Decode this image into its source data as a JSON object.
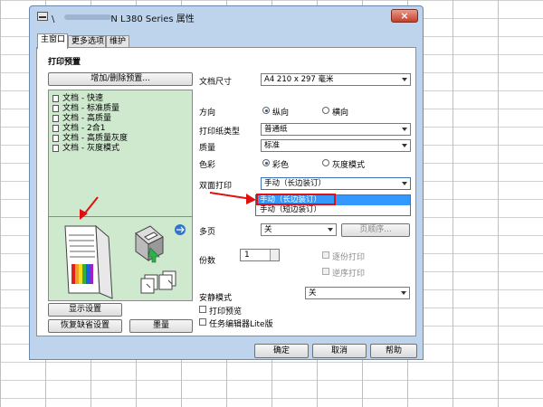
{
  "window": {
    "title_prefix": "\\",
    "title_suffix": "N L380 Series 属性",
    "close": "×"
  },
  "tabs": [
    {
      "label": "主窗口",
      "active": true
    },
    {
      "label": "更多选项",
      "active": false
    },
    {
      "label": "维护",
      "active": false
    }
  ],
  "left": {
    "section_title": "打印预置",
    "add_remove_button": "增加/删除预置...",
    "presets": [
      "文档 - 快速",
      "文档 - 标准质量",
      "文档 - 高质量",
      "文档 - 2合1",
      "文档 - 高质量灰度",
      "文档 - 灰度模式"
    ],
    "show_settings_button": "显示设置",
    "restore_defaults_button": "恢复缺省设置",
    "ink_button": "墨量"
  },
  "right": {
    "doc_size_label": "文档尺寸",
    "doc_size_value": "A4 210 x 297 毫米",
    "orientation_label": "方向",
    "portrait": "纵向",
    "landscape": "横向",
    "paper_type_label": "打印纸类型",
    "paper_type_value": "普通纸",
    "quality_label": "质量",
    "quality_value": "标准",
    "color_label": "色彩",
    "color_value": "彩色",
    "gray_value": "灰度模式",
    "duplex_label": "双面打印",
    "duplex_value": "手动（长边装订）",
    "duplex_options": [
      "手动（长边装订）",
      "手动（短边装订）"
    ],
    "multipage_label": "多页",
    "multipage_value": "关",
    "page_order_button": "页顺序...",
    "copies_label": "份数",
    "copies_value": "1",
    "collate_label": "逐份打印",
    "reverse_label": "逆序打印",
    "quiet_label": "安静模式",
    "quiet_value": "关",
    "print_preview_label": "打印预览",
    "job_arranger_label": "任务编辑器Lite版"
  },
  "buttons": {
    "ok": "确定",
    "cancel": "取消",
    "help": "帮助"
  },
  "colors": {
    "preview_bg": "#cfe9cf",
    "window_frame": "#bdd4ec",
    "annotation_red": "#e01010",
    "selection_blue": "#3399ff"
  }
}
